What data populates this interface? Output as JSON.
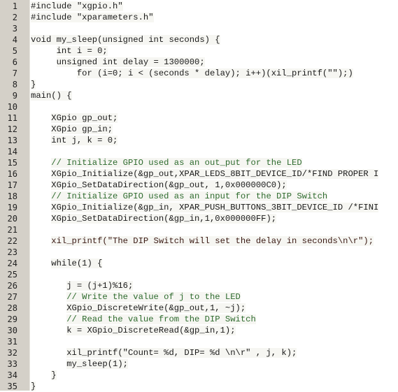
{
  "editor": {
    "colors": {
      "gutter_bg": "#d4d0c8",
      "code_bg": "#ffffff",
      "text": "#1a1a1a",
      "comment": "#2e6b2e"
    },
    "lines": [
      {
        "n": "1",
        "text": "#include \"xgpio.h\"",
        "kind": "code"
      },
      {
        "n": "2",
        "text": "#include \"xparameters.h\"",
        "kind": "code"
      },
      {
        "n": "3",
        "text": "",
        "kind": "code"
      },
      {
        "n": "4",
        "text": "void my_sleep(unsigned int seconds) {",
        "kind": "code"
      },
      {
        "n": "5",
        "text": "     int i = 0;",
        "kind": "code"
      },
      {
        "n": "6",
        "text": "     unsigned int delay = 1300000;",
        "kind": "code"
      },
      {
        "n": "7",
        "text": "         for (i=0; i < (seconds * delay); i++)(xil_printf(\"\");)",
        "kind": "code"
      },
      {
        "n": "8",
        "text": "}",
        "kind": "code"
      },
      {
        "n": "9",
        "text": "main() {",
        "kind": "code"
      },
      {
        "n": "10",
        "text": "",
        "kind": "code"
      },
      {
        "n": "11",
        "text": "    XGpio gp_out;",
        "kind": "code"
      },
      {
        "n": "12",
        "text": "    XGpio gp_in;",
        "kind": "code"
      },
      {
        "n": "13",
        "text": "    int j, k = 0;",
        "kind": "code"
      },
      {
        "n": "14",
        "text": "",
        "kind": "code"
      },
      {
        "n": "15",
        "text": "    // Initialize GPIO used as an out_put for the LED",
        "kind": "comment"
      },
      {
        "n": "16",
        "text": "    XGpio_Initialize(&gp_out,XPAR_LEDS_8BIT_DEVICE_ID/*FIND PROPER I",
        "kind": "code"
      },
      {
        "n": "17",
        "text": "    XGpio_SetDataDirection(&gp_out, 1,0x000000C0);",
        "kind": "code"
      },
      {
        "n": "18",
        "text": "    // Initialize GPIO used as an input for the DIP Switch",
        "kind": "comment"
      },
      {
        "n": "19",
        "text": "    XGpio_Initialize(&gp_in, XPAR_PUSH_BUTTONS_3BIT_DEVICE_ID /*FINI",
        "kind": "code"
      },
      {
        "n": "20",
        "text": "    XGpio_SetDataDirection(&gp_in,1,0x000000FF);",
        "kind": "code"
      },
      {
        "n": "21",
        "text": "",
        "kind": "code"
      },
      {
        "n": "22",
        "text": "    xil_printf(\"The DIP Switch will set the delay in seconds\\n\\r\");",
        "kind": "str"
      },
      {
        "n": "23",
        "text": "",
        "kind": "code"
      },
      {
        "n": "24",
        "text": "    while(1) {",
        "kind": "code"
      },
      {
        "n": "25",
        "text": "",
        "kind": "code"
      },
      {
        "n": "26",
        "text": "       j = (j+1)%16;",
        "kind": "code"
      },
      {
        "n": "27",
        "text": "       // Write the value of j to the LED",
        "kind": "comment"
      },
      {
        "n": "28",
        "text": "       XGpio_DiscreteWrite(&gp_out,1, ~j);",
        "kind": "code"
      },
      {
        "n": "29",
        "text": "       // Read the value from the DIP Switch",
        "kind": "comment"
      },
      {
        "n": "30",
        "text": "       k = XGpio_DiscreteRead(&gp_in,1);",
        "kind": "code"
      },
      {
        "n": "31",
        "text": "",
        "kind": "code"
      },
      {
        "n": "32",
        "text": "       xil_printf(\"Count= %d, DIP= %d \\n\\r\" , j, k);",
        "kind": "code"
      },
      {
        "n": "33",
        "text": "       my_sleep(1);",
        "kind": "code"
      },
      {
        "n": "34",
        "text": "    }",
        "kind": "code"
      },
      {
        "n": "35",
        "text": "}",
        "kind": "code"
      }
    ]
  }
}
